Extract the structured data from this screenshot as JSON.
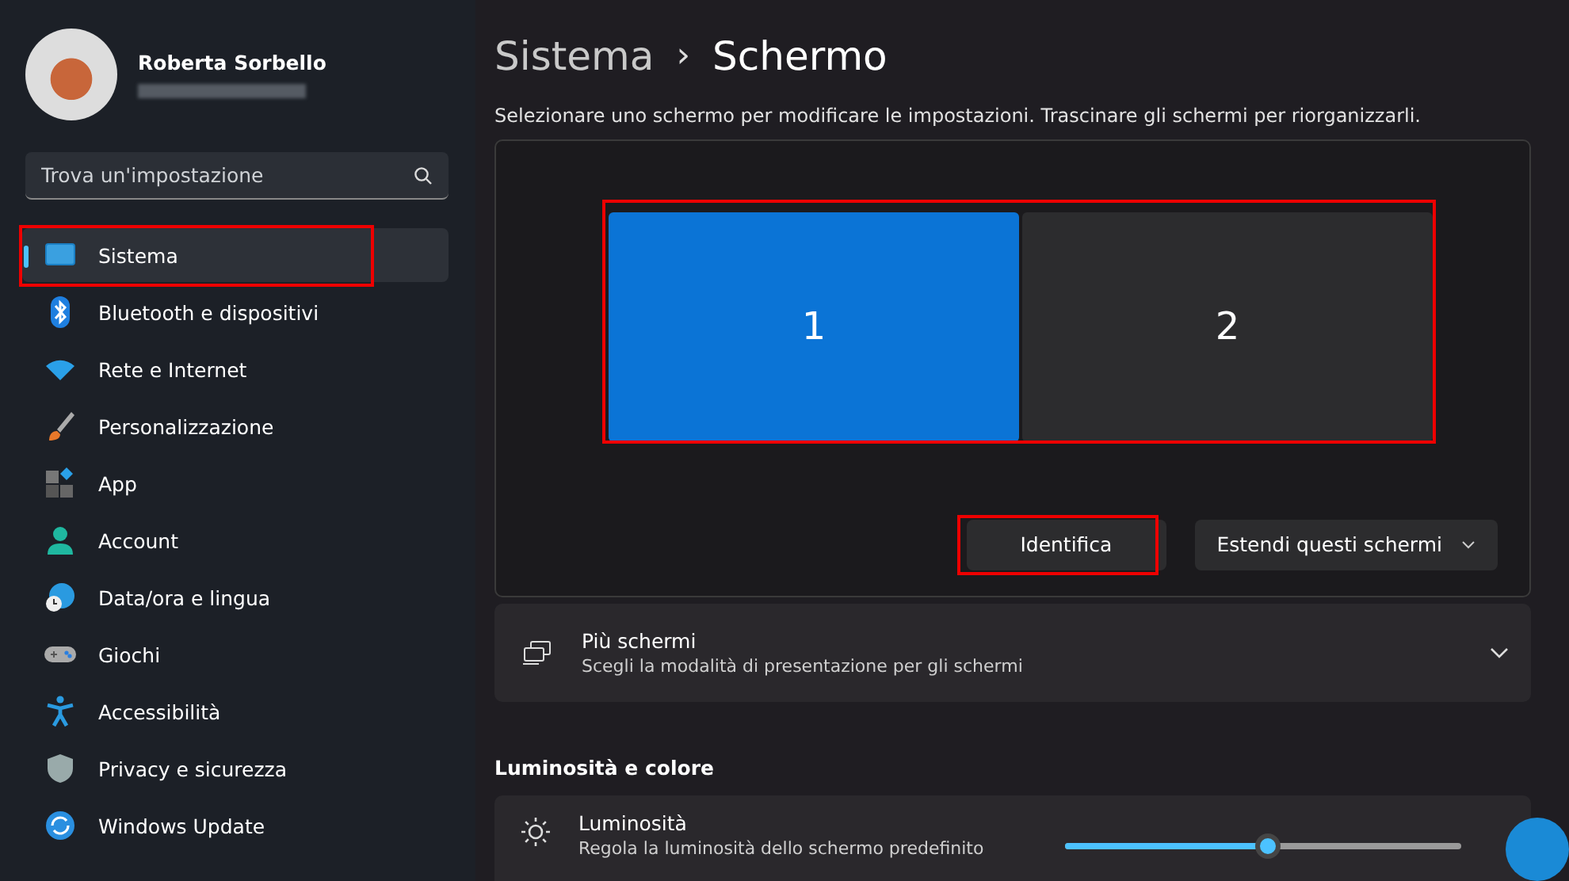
{
  "user": {
    "name": "Roberta Sorbello"
  },
  "search": {
    "placeholder": "Trova un'impostazione"
  },
  "sidebar": {
    "items": [
      {
        "label": "Sistema",
        "selected": true
      },
      {
        "label": "Bluetooth e dispositivi",
        "selected": false
      },
      {
        "label": "Rete e Internet",
        "selected": false
      },
      {
        "label": "Personalizzazione",
        "selected": false
      },
      {
        "label": "App",
        "selected": false
      },
      {
        "label": "Account",
        "selected": false
      },
      {
        "label": "Data/ora e lingua",
        "selected": false
      },
      {
        "label": "Giochi",
        "selected": false
      },
      {
        "label": "Accessibilità",
        "selected": false
      },
      {
        "label": "Privacy e sicurezza",
        "selected": false
      },
      {
        "label": "Windows Update",
        "selected": false
      }
    ]
  },
  "breadcrumb": {
    "parent": "Sistema",
    "separator": "›",
    "current": "Schermo"
  },
  "description": "Selezionare uno schermo per modificare le impostazioni. Trascinare gli schermi per riorganizzarli.",
  "displays": [
    {
      "label": "1",
      "selected": true
    },
    {
      "label": "2",
      "selected": false
    }
  ],
  "identify_button": "Identifica",
  "mode_dropdown": {
    "value": "Estendi questi schermi"
  },
  "multiple_displays": {
    "title": "Più schermi",
    "subtitle": "Scegli la modalità di presentazione per gli schermi",
    "expanded": false
  },
  "section_heading": "Luminosità e colore",
  "brightness": {
    "title": "Luminosità",
    "subtitle": "Regola la luminosità dello schermo predefinito",
    "level": 0.51
  }
}
